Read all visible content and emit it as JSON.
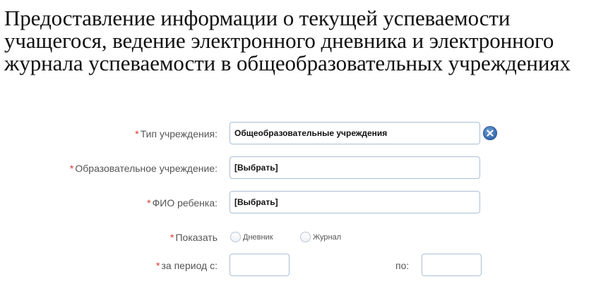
{
  "page": {
    "title": "Предоставление информации о текущей успеваемости учащегося, ведение электронного дневника и электронного журнала успеваемости в общеобразовательных учреждениях"
  },
  "form": {
    "required_mark": "*",
    "institution_type": {
      "label": "Тип учреждения:",
      "value": "Общеобразовательные учреждения",
      "clear_icon": "clear-icon"
    },
    "institution": {
      "label": "Образовательное учреждение:",
      "value": "[Выбрать]"
    },
    "child_name": {
      "label": "ФИО ребенка:",
      "value": "[Выбрать]"
    },
    "show": {
      "label": "Показать",
      "options": [
        {
          "label": "Дневник",
          "selected": false
        },
        {
          "label": "Журнал",
          "selected": false
        }
      ]
    },
    "period": {
      "from_label": "за период с:",
      "from_value": "",
      "to_label": "по:",
      "to_value": ""
    }
  },
  "colors": {
    "required": "#d9362b",
    "label_text": "#555555",
    "input_border": "#a9bfd6",
    "clear_button": "#3a6eae"
  }
}
